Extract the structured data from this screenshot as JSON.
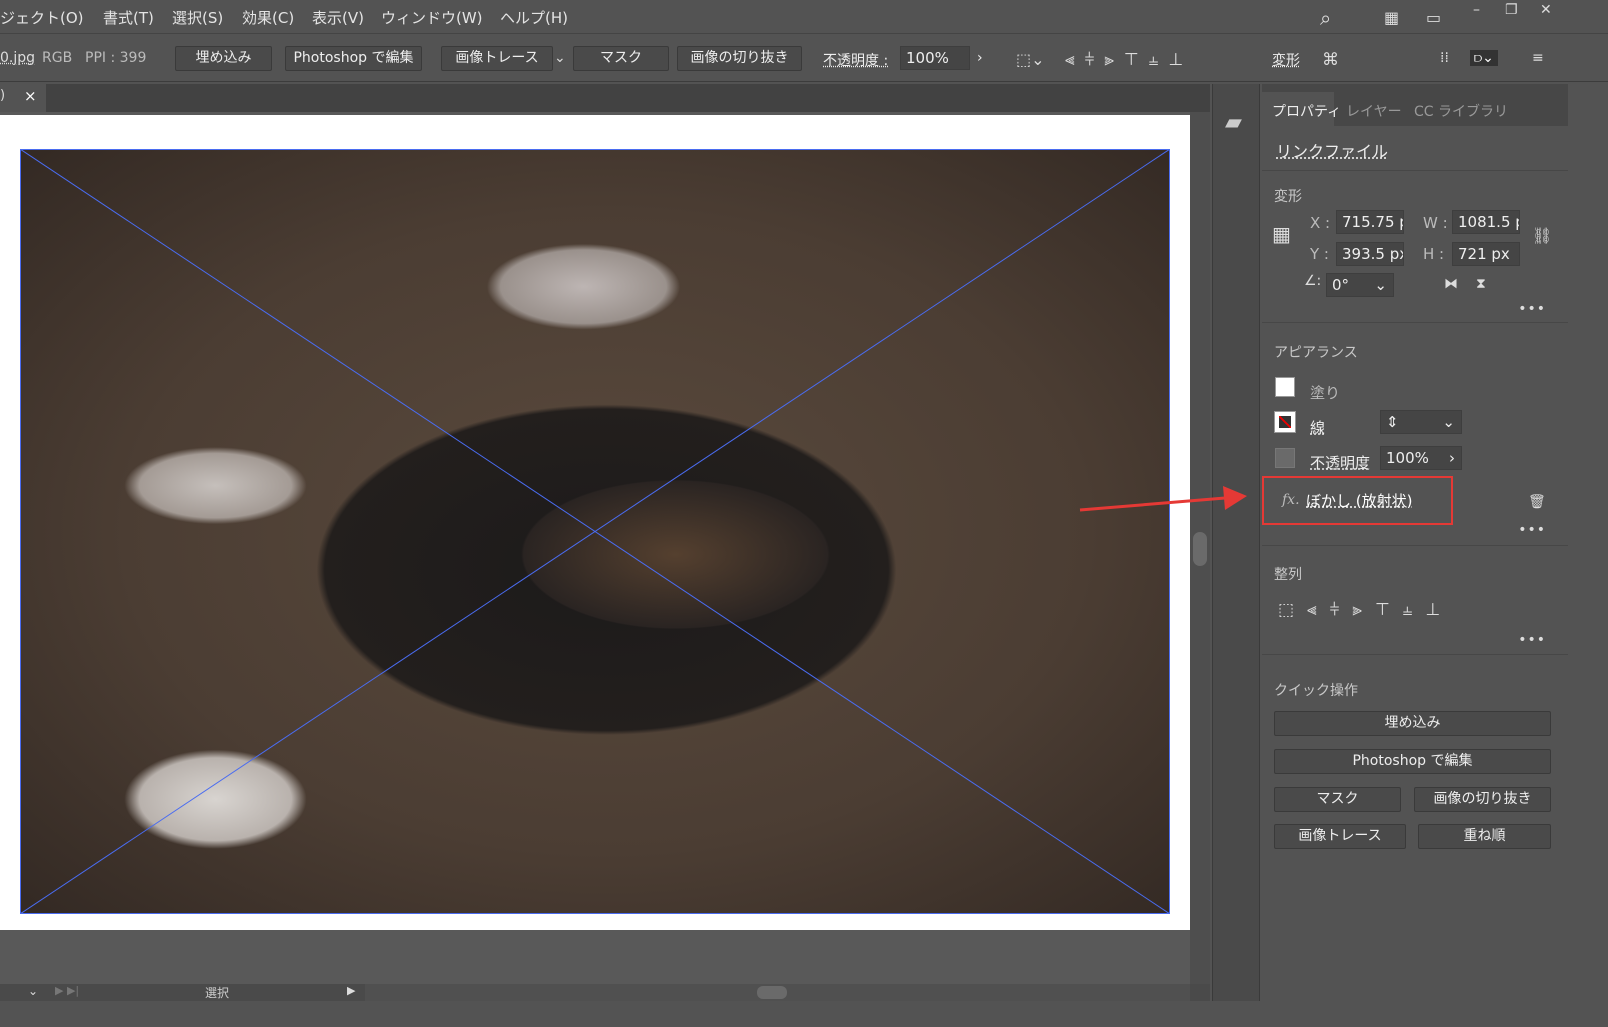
{
  "menubar": {
    "items": [
      "ジェクト(O)",
      "書式(T)",
      "選択(S)",
      "効果(C)",
      "表示(V)",
      "ウィンドウ(W)",
      "ヘルプ(H)"
    ]
  },
  "control": {
    "filename": "0.jpg",
    "colormode": "RGB",
    "ppi": "PPI : 399",
    "embed": "埋め込み",
    "edit_ps": "Photoshop で編集",
    "trace": "画像トレース",
    "mask": "マスク",
    "crop": "画像の切り抜き",
    "opacity_label": "不透明度 :",
    "opacity_value": "100%",
    "transform": "変形"
  },
  "tab": {
    "title": ")",
    "close": "×"
  },
  "panel": {
    "tabs": [
      "プロパティ",
      "レイヤー",
      "CC ライブラリ"
    ],
    "link_file": "リンクファイル",
    "transform": {
      "title": "変形",
      "x_label": "X :",
      "x": "715.75 p",
      "y_label": "Y :",
      "y": "393.5 px",
      "w_label": "W :",
      "w": "1081.5 p",
      "h_label": "H :",
      "h": "721 px",
      "angle": "0°"
    },
    "appearance": {
      "title": "アピアランス",
      "fill": "塗り",
      "stroke": "線",
      "opacity_label": "不透明度",
      "opacity": "100%",
      "effect": "ぼかし (放射状)",
      "fx": "fx."
    },
    "align": {
      "title": "整列"
    },
    "quick": {
      "title": "クイック操作",
      "embed": "埋め込み",
      "edit_ps": "Photoshop で編集",
      "mask": "マスク",
      "crop": "画像の切り抜き",
      "trace": "画像トレース",
      "arrange": "重ね順"
    }
  },
  "status": {
    "tool": "選択"
  },
  "colors": {
    "accent_highlight": "#e53935",
    "selection": "#4a6cf0"
  }
}
